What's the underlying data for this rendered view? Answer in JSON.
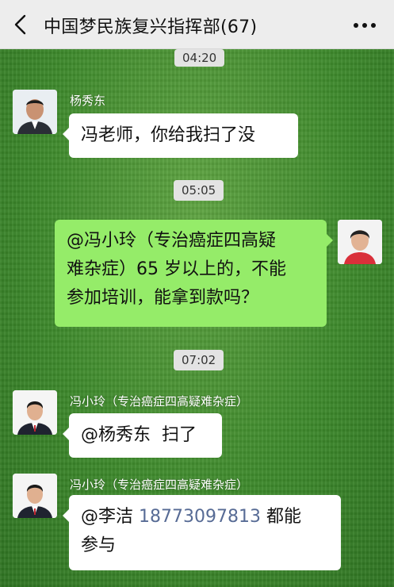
{
  "header": {
    "title": "中国梦民族复兴指挥部(67)",
    "back_icon": "chevron-left-icon",
    "more_icon": "more-dots-icon"
  },
  "messages": {
    "t1": "04:20",
    "m1_sender": "杨秀东",
    "m1_text": "冯老师，你给我扫了没",
    "t2": "05:05",
    "m2_line1": "@冯小玲（专治癌症四高疑",
    "m2_line2": "难杂症）65 岁以上的，不能",
    "m2_line3": "参加培训，能拿到款吗？",
    "t3": "07:02",
    "m3_sender": "冯小玲（专治癌症四高疑难杂症）",
    "m3_text": "@杨秀东  扫了",
    "m4_sender": "冯小玲（专治癌症四高疑难杂症）",
    "m4_prefix": "@李洁",
    "m4_phone": "18773097813",
    "m4_suffix": "都能",
    "m4_line2": "参与"
  },
  "colors": {
    "own_bubble": "#95ec69",
    "other_bubble": "#ffffff",
    "link": "#576b95"
  }
}
